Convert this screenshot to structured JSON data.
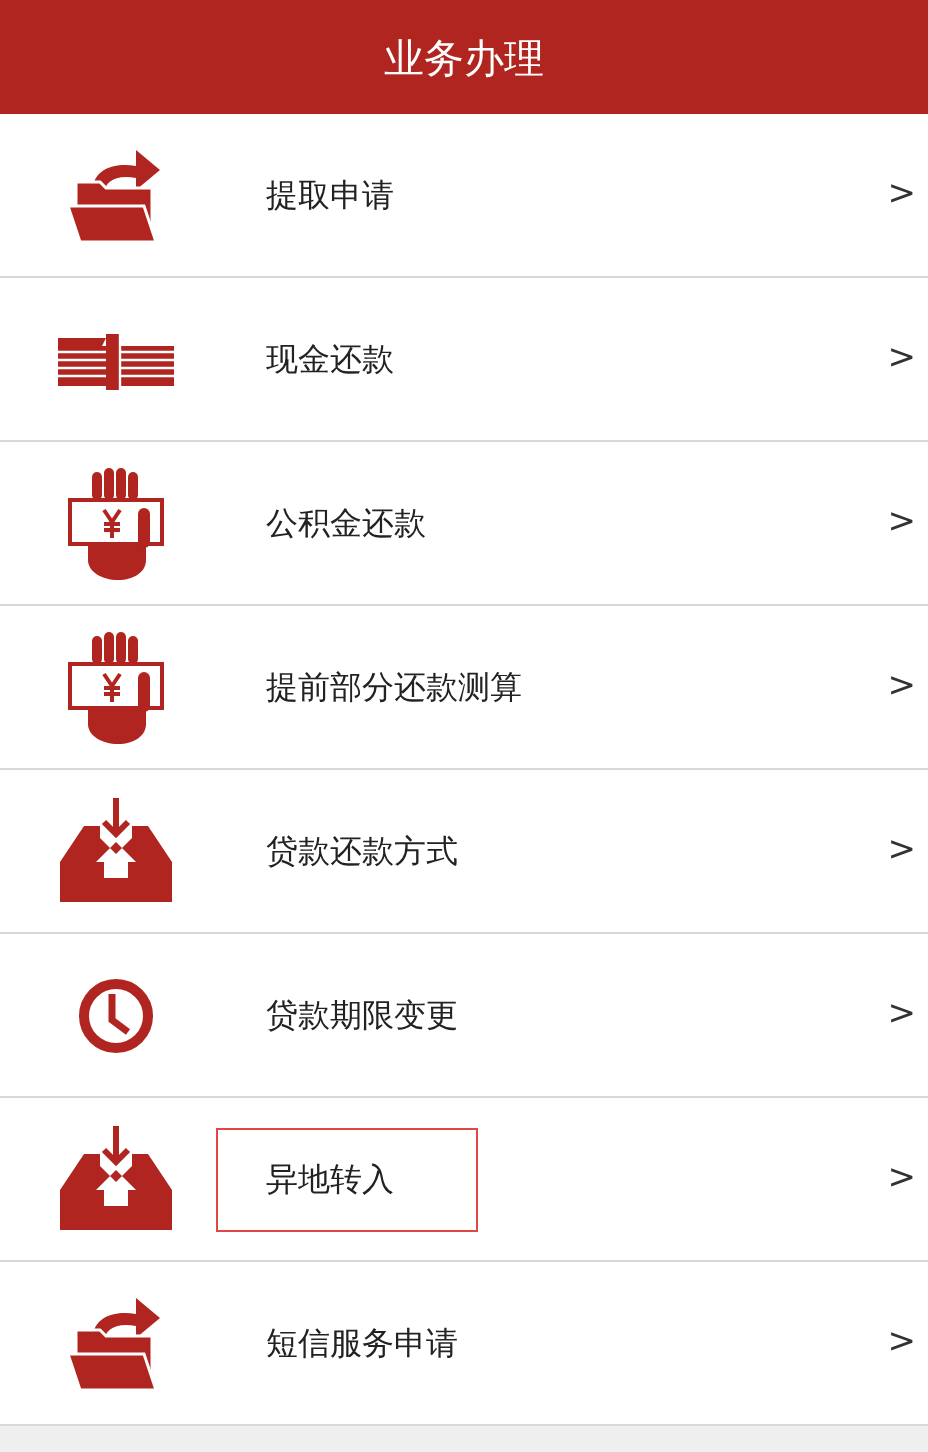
{
  "header": {
    "title": "业务办理"
  },
  "items": [
    {
      "kind": "folder",
      "label": "提取申请",
      "chevron": ">",
      "highlighted": false
    },
    {
      "kind": "cash",
      "label": "现金还款",
      "chevron": ">",
      "highlighted": false
    },
    {
      "kind": "hand",
      "label": "公积金还款",
      "chevron": ">",
      "highlighted": false
    },
    {
      "kind": "hand",
      "label": "提前部分还款测算",
      "chevron": ">",
      "highlighted": false
    },
    {
      "kind": "inbox",
      "label": "贷款还款方式",
      "chevron": ">",
      "highlighted": false
    },
    {
      "kind": "clock",
      "label": "贷款期限变更",
      "chevron": ">",
      "highlighted": false
    },
    {
      "kind": "inbox",
      "label": "异地转入",
      "chevron": ">",
      "highlighted": true
    },
    {
      "kind": "folder",
      "label": "短信服务申请",
      "chevron": ">",
      "highlighted": false
    }
  ]
}
